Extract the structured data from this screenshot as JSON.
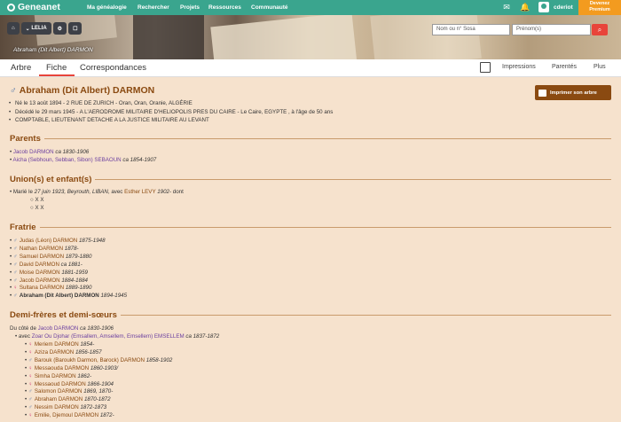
{
  "topbar": {
    "logo": "Geneanet",
    "nav": [
      "Ma généalogie",
      "Rechercher",
      "Projets",
      "Ressources",
      "Communauté"
    ],
    "username": "cderiot",
    "premium": [
      "Devenez",
      "Premium"
    ]
  },
  "header": {
    "home_icon": "home-icon",
    "tree_label": "LELIA",
    "breadcrumb": "Abraham (Dit Albert) DARMON",
    "search_placeholder1": "Nom ou n° Sosa",
    "search_placeholder2": "Prénom(s)"
  },
  "tabs": [
    "Arbre",
    "Fiche",
    "Correspondances"
  ],
  "right_links": [
    "Impressions",
    "Parentés",
    "Plus"
  ],
  "person": {
    "name": "Abraham (Dit Albert) DARMON",
    "print_label": "Imprimer son arbre",
    "info": [
      "Né le 13 août 1894 - 2 RUE DE ZURICH - Oran, Oran, Oranie, ALGÉRIE",
      "Décédé le 29 mars 1945 - A L'AERODROME MILITAIRE D'HELIOPOLIS PRES DU CAIRE - Le Caire, EGYPTE , à l'âge de 50 ans",
      "COMPTABLE, LIEUTENANT DETACHE A LA JUSTICE MILITAIRE AU LEVANT"
    ]
  },
  "sections": {
    "parents": "Parents",
    "unions": "Union(s) et enfant(s)",
    "fratrie": "Fratrie",
    "demi": "Demi-frères et demi-sœurs"
  },
  "parents": [
    {
      "name": "Jacob DARMON",
      "dates": "ca 1830-1906"
    },
    {
      "name": "Aicha (Sebhoun, Sebban, Sibon) SEBAOUN",
      "dates": "ca 1854-1907"
    }
  ],
  "union": {
    "prefix": "Marié le",
    "date": "27 juin 1923, Beyrouth, LIBAN",
    "with": ", avec",
    "spouse": "Esther LEVY",
    "spouse_dates": "1902-",
    "suffix": "dont",
    "children": [
      "X X",
      "X X"
    ]
  },
  "fratrie": [
    {
      "g": "m",
      "name": "Judas (Léon) DARMON",
      "dates": "1875-1948"
    },
    {
      "g": "m",
      "name": "Nathan DARMON",
      "dates": "1878-"
    },
    {
      "g": "m",
      "name": "Samuel DARMON",
      "dates": "1879-1880"
    },
    {
      "g": "m",
      "name": "David DARMON",
      "dates": "ca 1881-"
    },
    {
      "g": "m",
      "name": "Moise DARMON",
      "dates": "1881-1959"
    },
    {
      "g": "m",
      "name": "Jacob DARMON",
      "dates": "1884-1884"
    },
    {
      "g": "f",
      "name": "Sultana DARMON",
      "dates": "1889-1890"
    },
    {
      "g": "m",
      "name": "Abraham (Dit Albert) DARMON",
      "dates": "1894-1945",
      "self": true
    }
  ],
  "demi": {
    "side_prefix": "Du côté de",
    "side_name": "Jacob DARMON",
    "side_dates": "ca 1830-1906",
    "with_prefix": "avec",
    "with_name": "Zoar Ou Djohar (Emsallem, Amsellem, Emsellem) EMSELLEM",
    "with_dates": "ca 1837-1872",
    "children": [
      {
        "g": "f",
        "name": "Meriem DARMON",
        "dates": "1854-"
      },
      {
        "g": "f",
        "name": "Aziza DARMON",
        "dates": "1856-1857"
      },
      {
        "g": "m",
        "name": "Barouk (Baroukh Darmon, Barock) DARMON",
        "dates": "1858-1902"
      },
      {
        "g": "f",
        "name": "Messaouda DARMON",
        "dates": "1860-1903/"
      },
      {
        "g": "f",
        "name": "Simha DARMON",
        "dates": "1862-"
      },
      {
        "g": "f",
        "name": "Messaoud DARMON",
        "dates": "1866-1904"
      },
      {
        "g": "m",
        "name": "Salomon DARMON",
        "dates": "1869, 1870-"
      },
      {
        "g": "m",
        "name": "Abraham DARMON",
        "dates": "1870-1872"
      },
      {
        "g": "m",
        "name": "Nessim DARMON",
        "dates": "1872-1873"
      },
      {
        "g": "f",
        "name": "Emilie, Djemoul DARMON",
        "dates": "1872-"
      }
    ]
  },
  "colors": {
    "topbar": "#3aa58e",
    "accent": "#8a4a11",
    "background": "#f6e2cd",
    "premium": "#f39b1f"
  }
}
